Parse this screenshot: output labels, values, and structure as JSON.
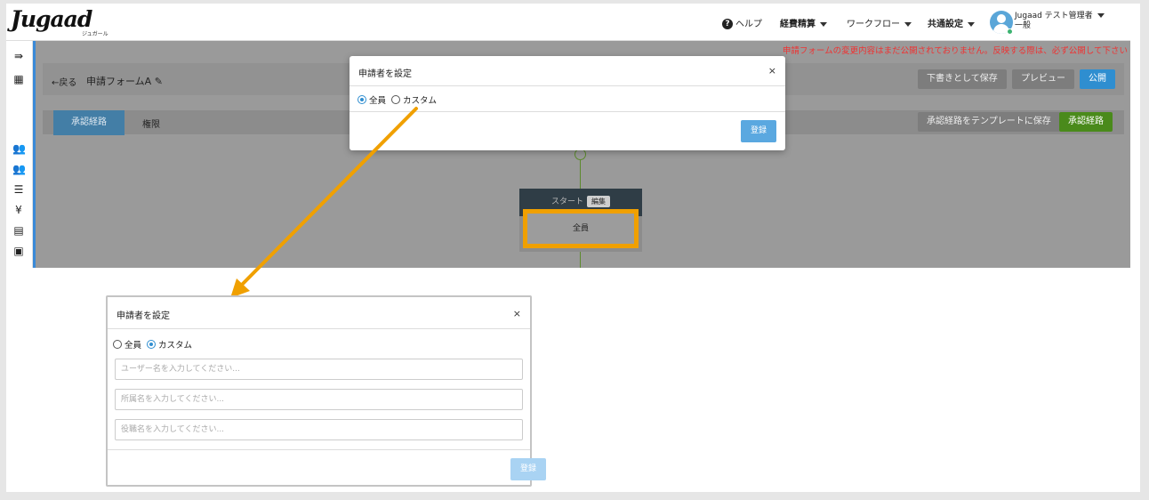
{
  "app": {
    "logo": "Jugaad",
    "logo_sub": "ジュガール"
  },
  "topnav": {
    "help": "ヘルプ",
    "expense": "経費精算",
    "workflow": "ワークフロー",
    "common": "共通設定",
    "user_name": "Jugaad テスト管理者",
    "user_role": "一般"
  },
  "warning": "申請フォームの変更内容はまだ公開されておりません。反映する際は、必ず公開して下さい",
  "form_header": {
    "back": "←戻る",
    "form_name": "申請フォームA",
    "save_draft": "下書きとして保存",
    "preview": "プレビュー",
    "publish": "公開"
  },
  "tabs": {
    "route": "承認経路",
    "permission": "権限",
    "save_template": "承認経路をテンプレートに保存",
    "route_btn": "承認経路"
  },
  "flow": {
    "start_label": "スタート",
    "edit_label": "編集",
    "target": "全員"
  },
  "modal_top": {
    "title": "申請者を設定",
    "close": "×",
    "option_all": "全員",
    "option_custom": "カスタム",
    "selected": "all",
    "register": "登録"
  },
  "modal_bottom": {
    "title": "申請者を設定",
    "close": "×",
    "option_all": "全員",
    "option_custom": "カスタム",
    "selected": "custom",
    "user_placeholder": "ユーザー名を入力してください...",
    "dept_placeholder": "所属名を入力してください...",
    "position_placeholder": "役職名を入力してください...",
    "register": "登録"
  },
  "colors": {
    "accent_blue": "#2f8ed0",
    "callout_orange": "#f0a000",
    "publish_green": "#4a8a1b",
    "warning_red": "#e33333"
  }
}
